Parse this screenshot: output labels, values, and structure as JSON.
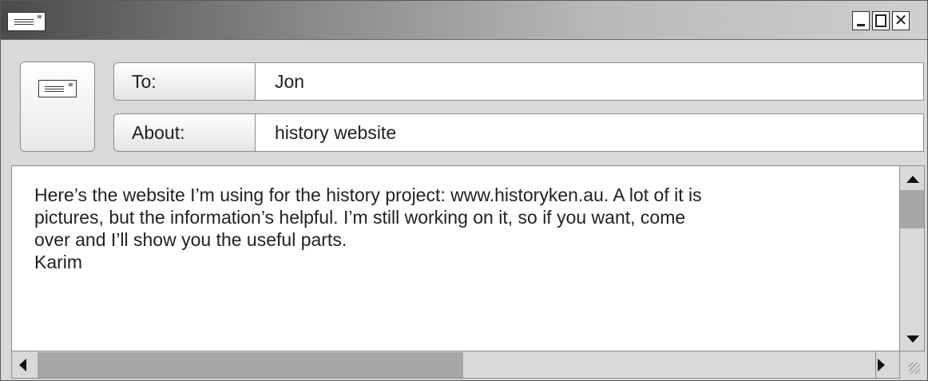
{
  "window": {
    "title_icon": "envelope-icon",
    "controls": {
      "minimize_icon": "minimize-icon",
      "maximize_icon": "maximize-icon",
      "close_label": "✕"
    }
  },
  "header": {
    "send_icon": "envelope-icon",
    "to_label": "To:",
    "to_value": "Jon",
    "about_label": "About:",
    "about_value": "history website"
  },
  "message": {
    "lines": [
      "Here’s the website I’m using for the history project: www.historyken.au. A lot of it is",
      "pictures, but the information’s helpful. I’m still working on it, so if you want, come",
      "over and I’ll show you the useful parts.",
      "Karim"
    ]
  },
  "scrollbars": {
    "vertical_position": 0.0,
    "horizontal_position": 0.0
  },
  "colors": {
    "titlebar_dark": "#4a4a4a",
    "titlebar_light": "#cfcfcf",
    "chrome": "#d9d9d9",
    "thumb": "#a6a6a6"
  }
}
